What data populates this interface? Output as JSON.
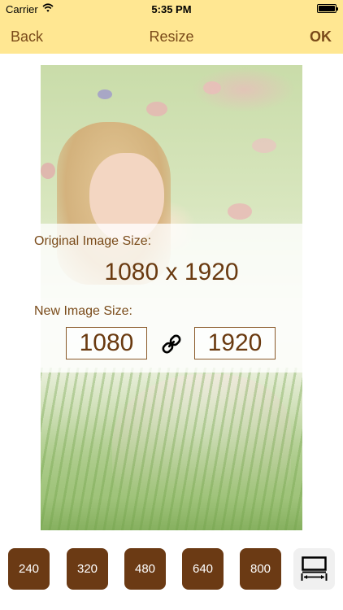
{
  "status_bar": {
    "carrier": "Carrier",
    "time": "5:35 PM",
    "icons": [
      "wifi-icon",
      "battery-icon"
    ]
  },
  "nav": {
    "back_label": "Back",
    "title": "Resize",
    "ok_label": "OK"
  },
  "resize_panel": {
    "original_label": "Original Image Size:",
    "original_value": "1080 x 1920",
    "new_label": "New Image Size:",
    "new_width": "1080",
    "new_height": "1920",
    "link_icon": "link-icon"
  },
  "toolbar": {
    "presets": [
      "240",
      "320",
      "480",
      "640",
      "800"
    ],
    "fit_icon": "fit-width-icon"
  },
  "colors": {
    "nav_background": "#ffe792",
    "accent_brown": "#6b3a14",
    "text_brown": "#7a4b1a"
  }
}
